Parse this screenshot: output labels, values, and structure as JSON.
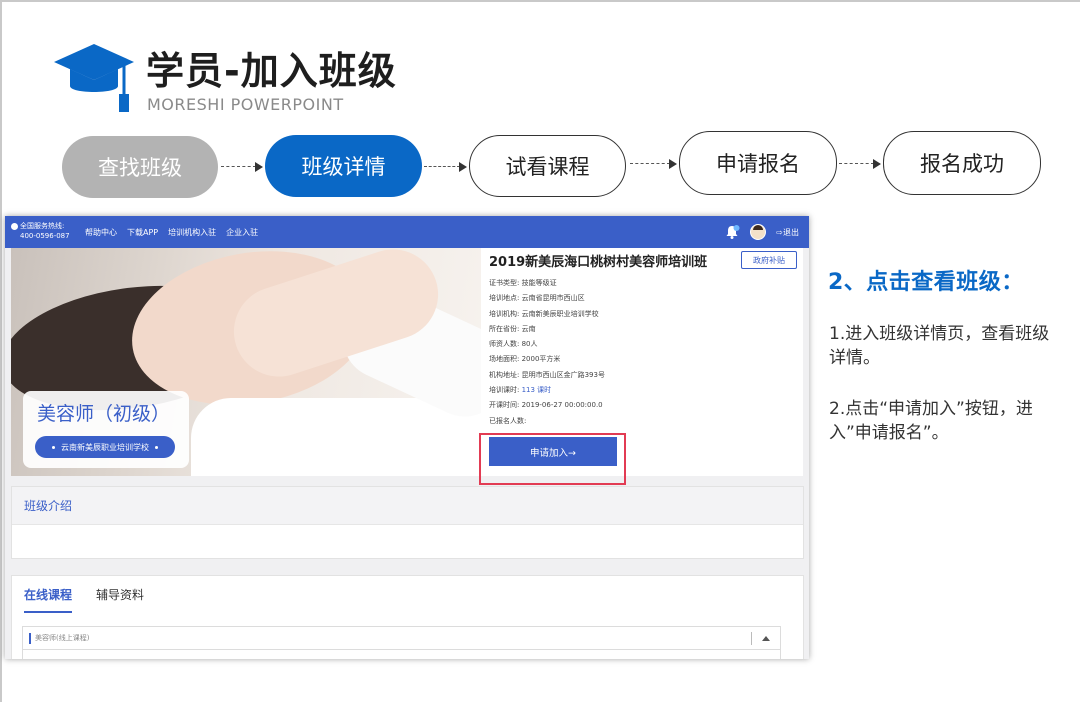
{
  "slide": {
    "title": "学员-加入班级",
    "subtitle": "MORESHI POWERPOINT",
    "colors": {
      "primary_blue": "#0a68c6",
      "inactive_gray": "#b3b3b3",
      "portal_blue": "#3a5fc8",
      "highlight_red": "#e23b53"
    }
  },
  "steps": [
    {
      "label": "查找班级",
      "state": "done"
    },
    {
      "label": "班级详情",
      "state": "current"
    },
    {
      "label": "试看课程",
      "state": "todo"
    },
    {
      "label": "申请报名",
      "state": "todo"
    },
    {
      "label": "报名成功",
      "state": "todo"
    }
  ],
  "screenshot": {
    "topnav": {
      "hotline_label": "全国服务热线:",
      "hotline_number": "400-0596-087",
      "links": [
        "帮助中心",
        "下载APP",
        "培训机构入驻",
        "企业入驻"
      ],
      "bell_icon": "bell-icon",
      "logout_label": "退出"
    },
    "course": {
      "badge_name": "美容师（初级）",
      "badge_school": "云南新美辰职业培训学校",
      "title": "2019新美辰海口桃树村美容师培训班",
      "tag": "政府补贴",
      "info": [
        {
          "label": "证书类型:",
          "value": "技能等级证"
        },
        {
          "label": "培训地点:",
          "value": "云南省昆明市西山区"
        },
        {
          "label": "培训机构:",
          "value": "云南新美辰职业培训学校"
        },
        {
          "label": "所在省份:",
          "value": "云南"
        },
        {
          "label": "师资人数:",
          "value": "80人"
        },
        {
          "label": "场地面积:",
          "value": "2000平方米"
        },
        {
          "label": "机构地址:",
          "value": "昆明市西山区金广路393号"
        },
        {
          "label": "培训课时:",
          "value": "113 课时"
        },
        {
          "label": "开课时间:",
          "value": "2019-06-27 00:00:00.0"
        },
        {
          "label": "已报名人数:",
          "value": ""
        }
      ],
      "apply_button": "申请加入→"
    },
    "intro_header": "班级介绍",
    "tabs": [
      "在线课程",
      "辅导资料"
    ],
    "course_row_label": "美容师(线上课程)"
  },
  "side": {
    "heading": "2、点击查看班级：",
    "desc1": "1.进入班级详情页，查看班级详情。",
    "desc2": "2.点击“申请加入”按钮，进入”申请报名”。"
  }
}
